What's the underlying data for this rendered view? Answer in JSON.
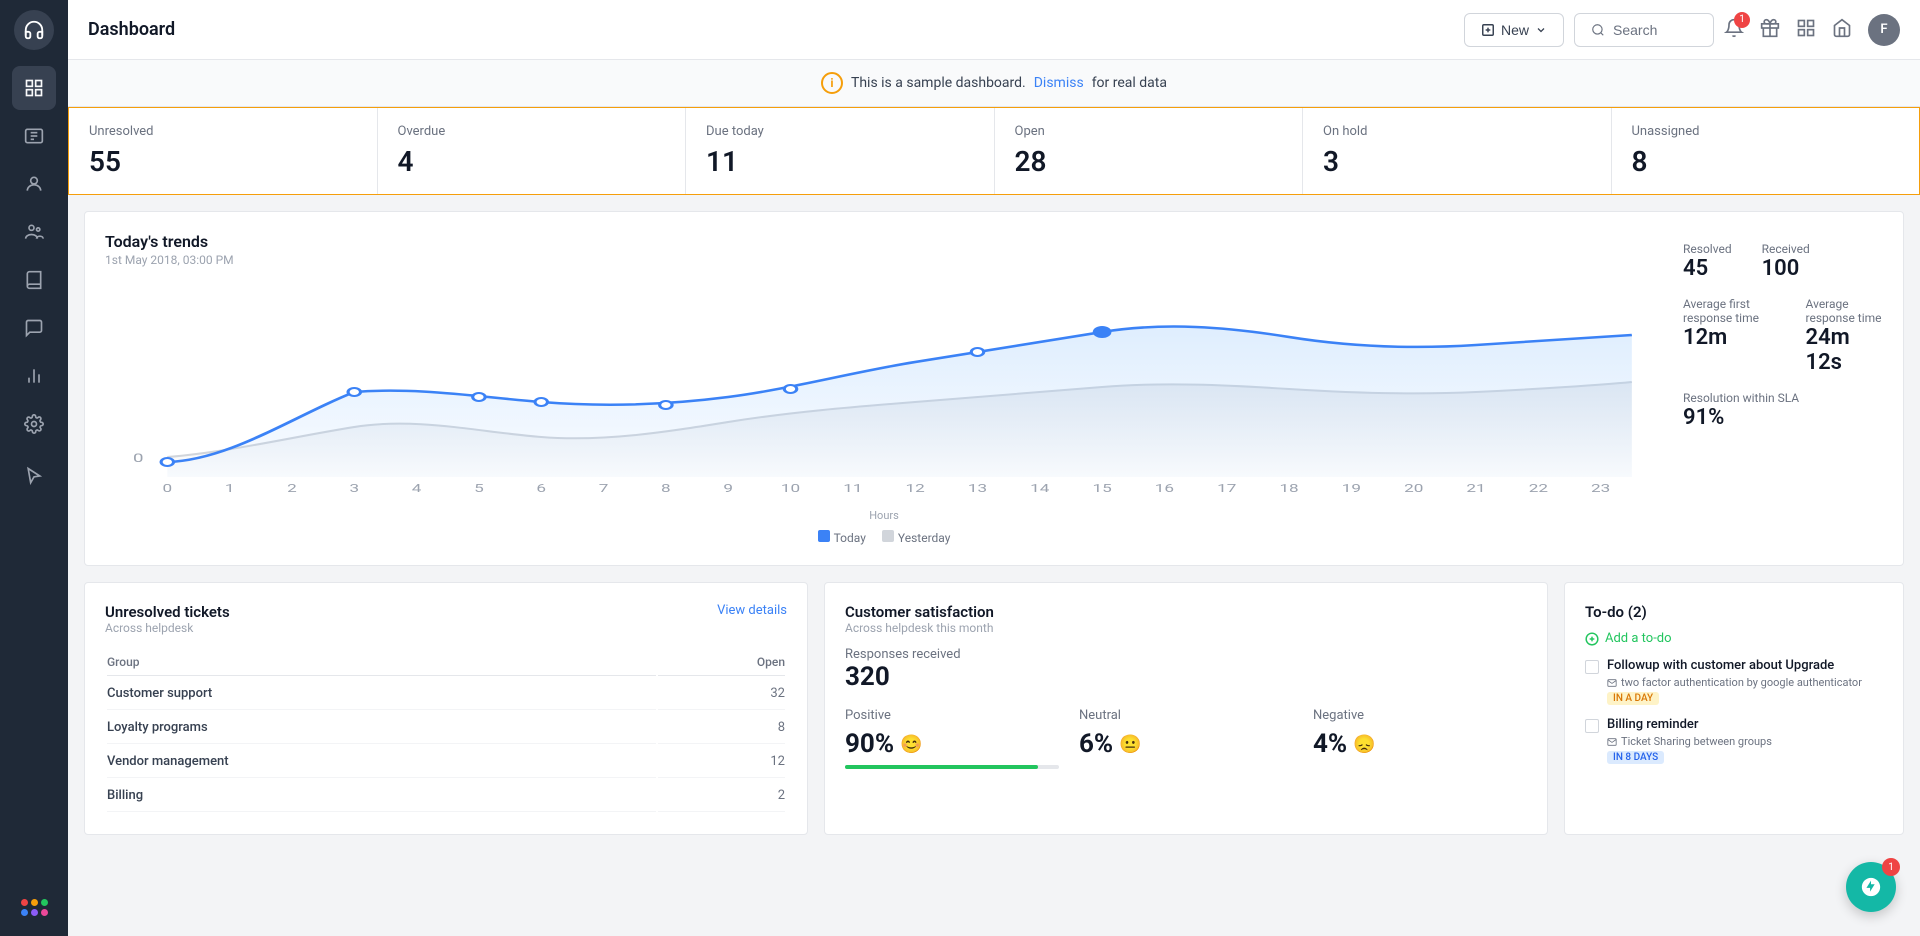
{
  "sidebar": {
    "logo": "🎧",
    "items": [
      {
        "name": "dashboard",
        "label": "Dashboard",
        "active": true
      },
      {
        "name": "tickets",
        "label": "Tickets"
      },
      {
        "name": "contacts",
        "label": "Contacts"
      },
      {
        "name": "groups",
        "label": "Groups"
      },
      {
        "name": "knowledge",
        "label": "Knowledge Base"
      },
      {
        "name": "conversations",
        "label": "Conversations"
      },
      {
        "name": "reports",
        "label": "Reports"
      },
      {
        "name": "settings",
        "label": "Settings"
      },
      {
        "name": "cursor",
        "label": "Cursor"
      }
    ],
    "dots": [
      {
        "color": "#ef4444"
      },
      {
        "color": "#f59e0b"
      },
      {
        "color": "#22c55e"
      },
      {
        "color": "#3b82f6"
      },
      {
        "color": "#8b5cf6"
      },
      {
        "color": "#ec4899"
      }
    ]
  },
  "topbar": {
    "title": "Dashboard",
    "new_label": "New",
    "search_placeholder": "Search",
    "badge_count": "1",
    "avatar_initial": "F"
  },
  "banner": {
    "text": "This is a sample dashboard.",
    "dismiss_label": "Dismiss",
    "suffix": "for real data"
  },
  "stats": [
    {
      "label": "Unresolved",
      "value": "55"
    },
    {
      "label": "Overdue",
      "value": "4"
    },
    {
      "label": "Due today",
      "value": "11"
    },
    {
      "label": "Open",
      "value": "28"
    },
    {
      "label": "On hold",
      "value": "3"
    },
    {
      "label": "Unassigned",
      "value": "8"
    }
  ],
  "trends": {
    "title": "Today's trends",
    "date": "1st May 2018, 03:00 PM",
    "resolved_label": "Resolved",
    "resolved_value": "45",
    "received_label": "Received",
    "received_value": "100",
    "avg_first_response_label": "Average first response time",
    "avg_first_response_value": "12m",
    "avg_response_label": "Average response time",
    "avg_response_value": "24m 12s",
    "sla_label": "Resolution within SLA",
    "sla_value": "91%",
    "legend_today": "Today",
    "legend_yesterday": "Yesterday",
    "x_axis": [
      "0",
      "1",
      "2",
      "3",
      "4",
      "5",
      "6",
      "7",
      "8",
      "9",
      "10",
      "11",
      "12",
      "13",
      "14",
      "15",
      "16",
      "17",
      "18",
      "19",
      "20",
      "21",
      "22",
      "23"
    ],
    "x_label": "Hours",
    "y_label": "0"
  },
  "unresolved_tickets": {
    "title": "Unresolved tickets",
    "subtitle": "Across helpdesk",
    "view_details": "View details",
    "col_group": "Group",
    "col_open": "Open",
    "rows": [
      {
        "group": "Customer support",
        "open": "32"
      },
      {
        "group": "Loyalty programs",
        "open": "8"
      },
      {
        "group": "Vendor management",
        "open": "12"
      },
      {
        "group": "Billing",
        "open": "2"
      }
    ]
  },
  "customer_satisfaction": {
    "title": "Customer satisfaction",
    "subtitle": "Across helpdesk this month",
    "responses_label": "Responses received",
    "responses_value": "320",
    "positive_label": "Positive",
    "positive_value": "90%",
    "positive_color": "#22c55e",
    "neutral_label": "Neutral",
    "neutral_value": "6%",
    "neutral_color": "#f59e0b",
    "negative_label": "Negative",
    "negative_value": "4%",
    "negative_color": "#ef4444"
  },
  "todo": {
    "title": "To-do (2)",
    "add_label": "Add a to-do",
    "items": [
      {
        "title": "Followup with customer about Upgrade",
        "meta": "two factor authentication by google authenticator",
        "tag": "IN A DAY",
        "tag_type": "warning"
      },
      {
        "title": "Billing reminder",
        "meta": "Ticket Sharing between groups",
        "tag": "IN 8 DAYS",
        "tag_type": "blue"
      }
    ]
  },
  "floating": {
    "badge": "1"
  }
}
